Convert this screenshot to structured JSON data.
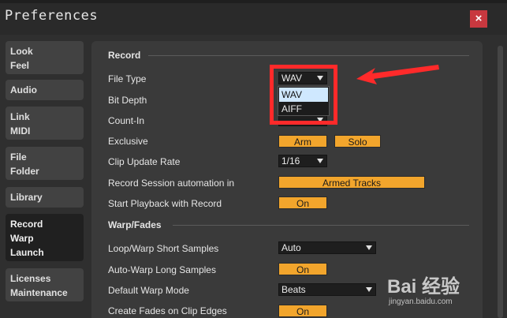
{
  "window": {
    "title": "Preferences",
    "close_label": "×"
  },
  "sidebar": {
    "items": [
      {
        "lines": [
          "Look",
          "Feel"
        ]
      },
      {
        "lines": [
          "Audio"
        ]
      },
      {
        "lines": [
          "Link",
          "MIDI"
        ]
      },
      {
        "lines": [
          "File",
          "Folder"
        ]
      },
      {
        "lines": [
          "Library"
        ]
      },
      {
        "lines": [
          "Record",
          "Warp",
          "Launch"
        ]
      },
      {
        "lines": [
          "Licenses",
          "Maintenance"
        ]
      }
    ],
    "active": "Record Warp Launch"
  },
  "record": {
    "header": "Record",
    "file_type": {
      "label": "File Type",
      "value": "WAV",
      "options": [
        "WAV",
        "AIFF"
      ]
    },
    "bit_depth": {
      "label": "Bit Depth"
    },
    "count_in": {
      "label": "Count-In"
    },
    "exclusive": {
      "label": "Exclusive",
      "arm": "Arm",
      "solo": "Solo"
    },
    "clip_update_rate": {
      "label": "Clip Update Rate",
      "value": "1/16"
    },
    "record_session_automation": {
      "label": "Record Session automation in",
      "value": "Armed Tracks"
    },
    "start_playback": {
      "label": "Start Playback with Record",
      "value": "On"
    }
  },
  "warp": {
    "header": "Warp/Fades",
    "loop_warp_short": {
      "label": "Loop/Warp Short Samples",
      "value": "Auto"
    },
    "auto_warp_long": {
      "label": "Auto-Warp Long Samples",
      "value": "On"
    },
    "default_warp_mode": {
      "label": "Default Warp Mode",
      "value": "Beats"
    },
    "create_fades": {
      "label": "Create Fades on Clip Edges",
      "value": "On"
    }
  },
  "colors": {
    "accent_orange": "#f2a52c",
    "annotation_red": "#ff2a2a",
    "close_red": "#c8383f"
  },
  "watermark": {
    "logo": "Bai 经验",
    "url": "jingyan.baidu.com"
  }
}
